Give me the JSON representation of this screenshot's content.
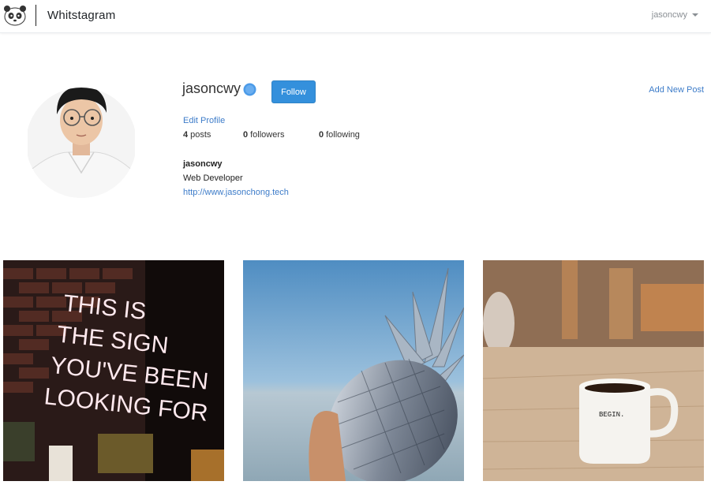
{
  "navbar": {
    "brand": "Whitstagram",
    "user": "jasoncwy"
  },
  "profile": {
    "username": "jasoncwy",
    "follow_label": "Follow",
    "add_post_label": "Add New Post",
    "edit_profile_label": "Edit Profile",
    "stats": {
      "posts_count": "4",
      "posts_label": "posts",
      "followers_count": "0",
      "followers_label": "followers",
      "following_count": "0",
      "following_label": "following"
    },
    "bio": {
      "name": "jasoncwy",
      "description": "Web Developer",
      "url": "http://www.jasonchong.tech"
    }
  },
  "posts": [
    {
      "image": "neon-sign-photo",
      "neon_text": [
        "THIS IS",
        "THE SIGN",
        "YOU'VE BEEN",
        "LOOKING FOR"
      ]
    },
    {
      "image": "silver-pineapple-photo"
    },
    {
      "image": "coffee-mug-photo",
      "mug_text": "BEGIN."
    }
  ],
  "colors": {
    "accent": "#3490dc",
    "link": "#3d7cc9",
    "verified": "#4c9be8"
  }
}
